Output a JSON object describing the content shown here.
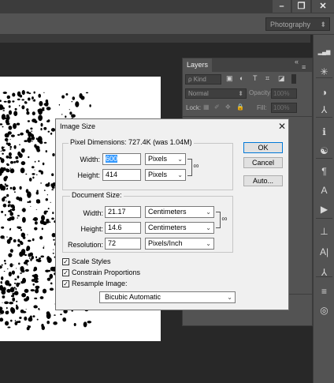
{
  "window": {
    "minimize_glyph": "–",
    "restore_glyph": "❐",
    "close_glyph": "✕"
  },
  "workspace": {
    "label": "Photography",
    "chevron_glyph": "⬍"
  },
  "layers_panel": {
    "title": "Layers",
    "collapse_glyph": "«",
    "menu_glyph": "≡",
    "kind_label": "ρ Kind",
    "filter_glyphs": [
      "▣",
      "◐",
      "T",
      "⌗",
      "◪"
    ],
    "blend_mode": "Normal",
    "opacity_label": "Opacity:",
    "opacity_value": "100%",
    "lock_label": "Lock:",
    "lock_glyphs": [
      "▦",
      "✐",
      "✥",
      "🔒"
    ],
    "fill_label": "Fill:",
    "fill_value": "100%",
    "chevron_glyph": "⬍"
  },
  "right_tools": [
    {
      "name": "histogram-icon",
      "glyph": "▂▄▆"
    },
    {
      "name": "adjustments-icon",
      "glyph": "✳"
    },
    {
      "name": "color-icon",
      "glyph": "◑"
    },
    {
      "name": "navigator-icon",
      "glyph": "⅄"
    },
    {
      "name": "info-icon",
      "glyph": "ℹ"
    },
    {
      "name": "styles-icon",
      "glyph": "☯"
    },
    {
      "name": "paragraph-icon",
      "glyph": "¶"
    },
    {
      "name": "character-icon",
      "glyph": "A"
    },
    {
      "name": "actions-icon",
      "glyph": "▶"
    },
    {
      "name": "brush-icon",
      "glyph": "⊥"
    },
    {
      "name": "glyphs-icon",
      "glyph": "A|"
    },
    {
      "name": "clone-source-icon",
      "glyph": "⅄"
    },
    {
      "name": "properties-icon",
      "glyph": "≡"
    },
    {
      "name": "libraries-icon",
      "glyph": "◎"
    }
  ],
  "dialog": {
    "title": "Image Size",
    "close_glyph": "✕",
    "pixel_dimensions": {
      "label": "Pixel Dimensions:",
      "size": "727.4K (was 1.04M)",
      "width_label": "Width:",
      "width_value": "600",
      "width_unit": "Pixels",
      "height_label": "Height:",
      "height_value": "414",
      "height_unit": "Pixels"
    },
    "document_size": {
      "label": "Document Size:",
      "width_label": "Width:",
      "width_value": "21.17",
      "width_unit": "Centimeters",
      "height_label": "Height:",
      "height_value": "14.6",
      "height_unit": "Centimeters",
      "resolution_label": "Resolution:",
      "resolution_value": "72",
      "resolution_unit": "Pixels/Inch"
    },
    "scale_styles": {
      "label": "Scale Styles",
      "checked": true
    },
    "constrain_proportions": {
      "label": "Constrain Proportions",
      "checked": true
    },
    "resample_image": {
      "label": "Resample Image:",
      "checked": true
    },
    "resample_method": "Bicubic Automatic",
    "ok_label": "OK",
    "cancel_label": "Cancel",
    "auto_label": "Auto...",
    "chevron_glyph": "⌄",
    "link_glyph": "∞",
    "check_glyph": "✓"
  }
}
